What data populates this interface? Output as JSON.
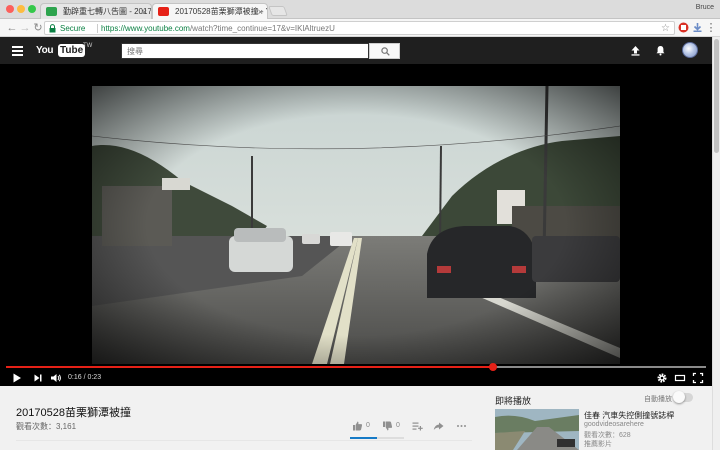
{
  "browser": {
    "tabs": [
      {
        "title": "勤辟重七轉八告圖 - 20170528..."
      },
      {
        "title": "20170528苗栗獅潭被撞 - You..."
      }
    ],
    "profile_name": "Bruce",
    "secure_label": "Secure",
    "url_host": "https://www.youtube.com",
    "url_path": "/watch?time_continue=17&v=IKlAltruezU"
  },
  "header": {
    "logo_you": "You",
    "logo_tube": "Tube",
    "logo_region": "TW",
    "search_placeholder": "搜尋"
  },
  "player": {
    "current_time": "0:16",
    "time_separator": " / ",
    "duration": "0:23",
    "progress_fraction": 0.696
  },
  "video": {
    "title": "20170528苗栗獅潭被撞",
    "views": "觀看次數：3,161",
    "likes": "0",
    "dislikes": "0",
    "like_fraction": 0.5
  },
  "sidebar": {
    "up_next_label": "即將播放",
    "autoplay_label": "自動播放",
    "autoplay_on": false,
    "recommended": [
      {
        "title": "佳春 汽車失控側撞號誌桿",
        "channel": "goodvideosarehere",
        "views": "觀看次數：628",
        "extra": "推薦影片"
      }
    ]
  },
  "colors": {
    "youtube_red": "#e62117",
    "header_bg": "#1f1f1f",
    "secure_green": "#0b8043",
    "like_blue": "#167ac6"
  }
}
